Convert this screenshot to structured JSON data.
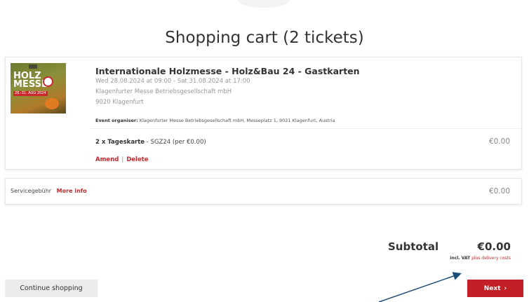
{
  "page": {
    "title": "Shopping cart (2 tickets)"
  },
  "event": {
    "thumbnail_text": [
      "HOLZ",
      "MESSE"
    ],
    "thumbnail_dates": "28.-31. AUG 2024",
    "title": "Internationale Holzmesse - Holz&Bau 24 - Gastkarten",
    "date_range": "Wed 28.08.2024 at 09:00 - Sat 31.08.2024 at 17:00",
    "venue": "Klagenfurter Messe Betriebsgesellschaft mbH",
    "city": "9020 Klagenfurt",
    "organiser_label": "Event organiser:",
    "organiser_value": "Klagenfurter Messe Betriebsgesellschaft mbH, Messeplatz 1, 9021 Klagenfurt, Austria"
  },
  "ticket": {
    "name": "2 x Tageskarte",
    "code": "SGZ24",
    "per_price": "(per €0.00)",
    "price": "€0.00",
    "amend_label": "Amend",
    "separator": "|",
    "delete_label": "Delete"
  },
  "fee": {
    "label": "Servicegebühr",
    "more_info": "More info",
    "price": "€0.00"
  },
  "summary": {
    "subtotal_label": "Subtotal",
    "subtotal_value": "€0.00",
    "vat_prefix": "incl. VAT",
    "vat_link": "plus delivery costs"
  },
  "buttons": {
    "continue_label": "Continue shopping",
    "next_label": "Next",
    "next_chevron": "›"
  },
  "colors": {
    "accent": "#c22026",
    "link": "#c9282d",
    "annotation_arrow": "#1f4e79"
  }
}
